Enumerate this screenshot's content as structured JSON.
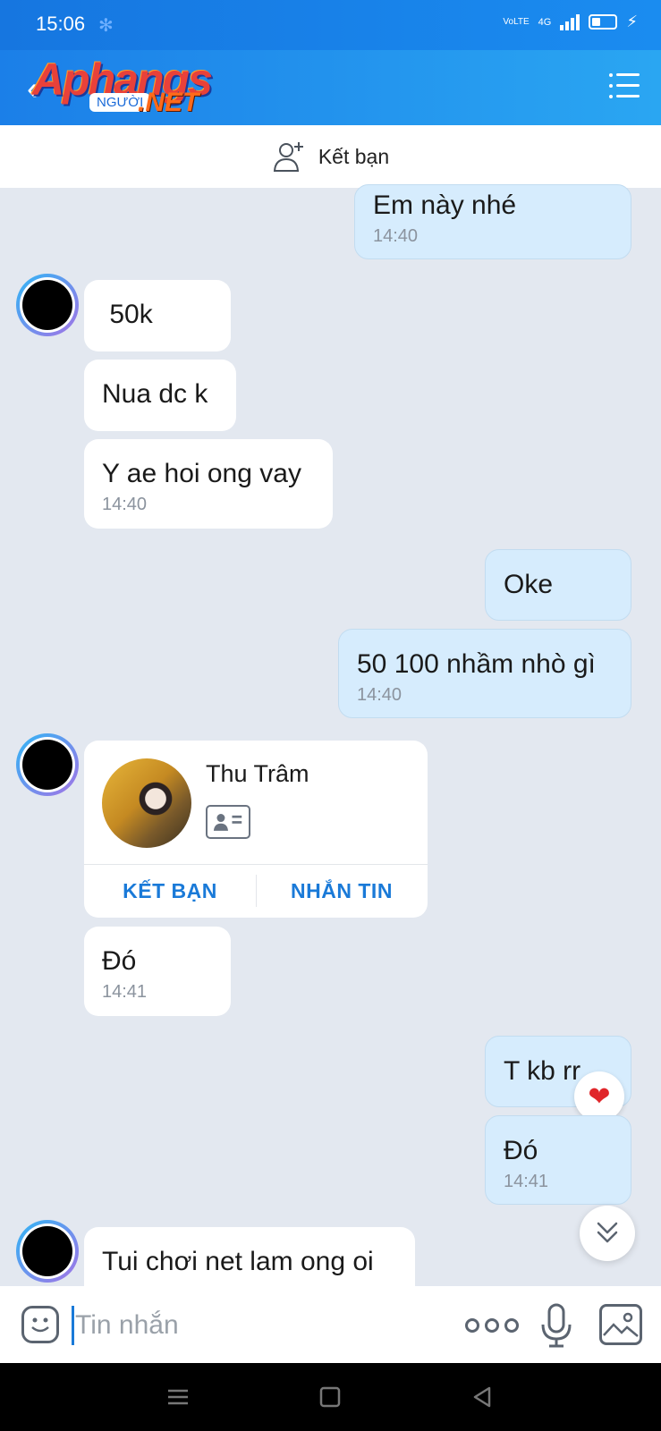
{
  "status_bar": {
    "time": "15:06",
    "network": "4G",
    "volte": "VoLTE"
  },
  "header": {
    "logo_main": "Aphangs",
    "logo_sub": "NGƯỜI",
    "logo_net": ".NET"
  },
  "friend_bar": {
    "label": "Kết bạn"
  },
  "messages": [
    {
      "dir": "out",
      "text": "Em này nhé",
      "time": "14:40"
    },
    {
      "dir": "in",
      "text": " 50k",
      "time": ""
    },
    {
      "dir": "in",
      "text": "Nua dc k",
      "time": ""
    },
    {
      "dir": "in",
      "text": "Y ae hoi ong vay",
      "time": "14:40"
    },
    {
      "dir": "out",
      "text": "Oke",
      "time": ""
    },
    {
      "dir": "out",
      "text": "50 100 nhầm nhò gì",
      "time": "14:40"
    },
    {
      "dir": "in",
      "text": "Đó",
      "time": "14:41"
    },
    {
      "dir": "out",
      "text": "T kb rr",
      "time": ""
    },
    {
      "dir": "out",
      "text": "Đó",
      "time": "14:41"
    },
    {
      "dir": "in",
      "text": "Tui chơi net lam ong oi",
      "time": ""
    }
  ],
  "contact_card": {
    "name": "Thu Trâm",
    "add_friend": "KẾT BẠN",
    "message": "NHẮN TIN"
  },
  "reaction": "❤",
  "input": {
    "placeholder": "Tin nhắn"
  },
  "colors": {
    "accent": "#1a7ad8",
    "outgoing_bubble": "#d6ecfd",
    "background": "#e3e8f0"
  }
}
